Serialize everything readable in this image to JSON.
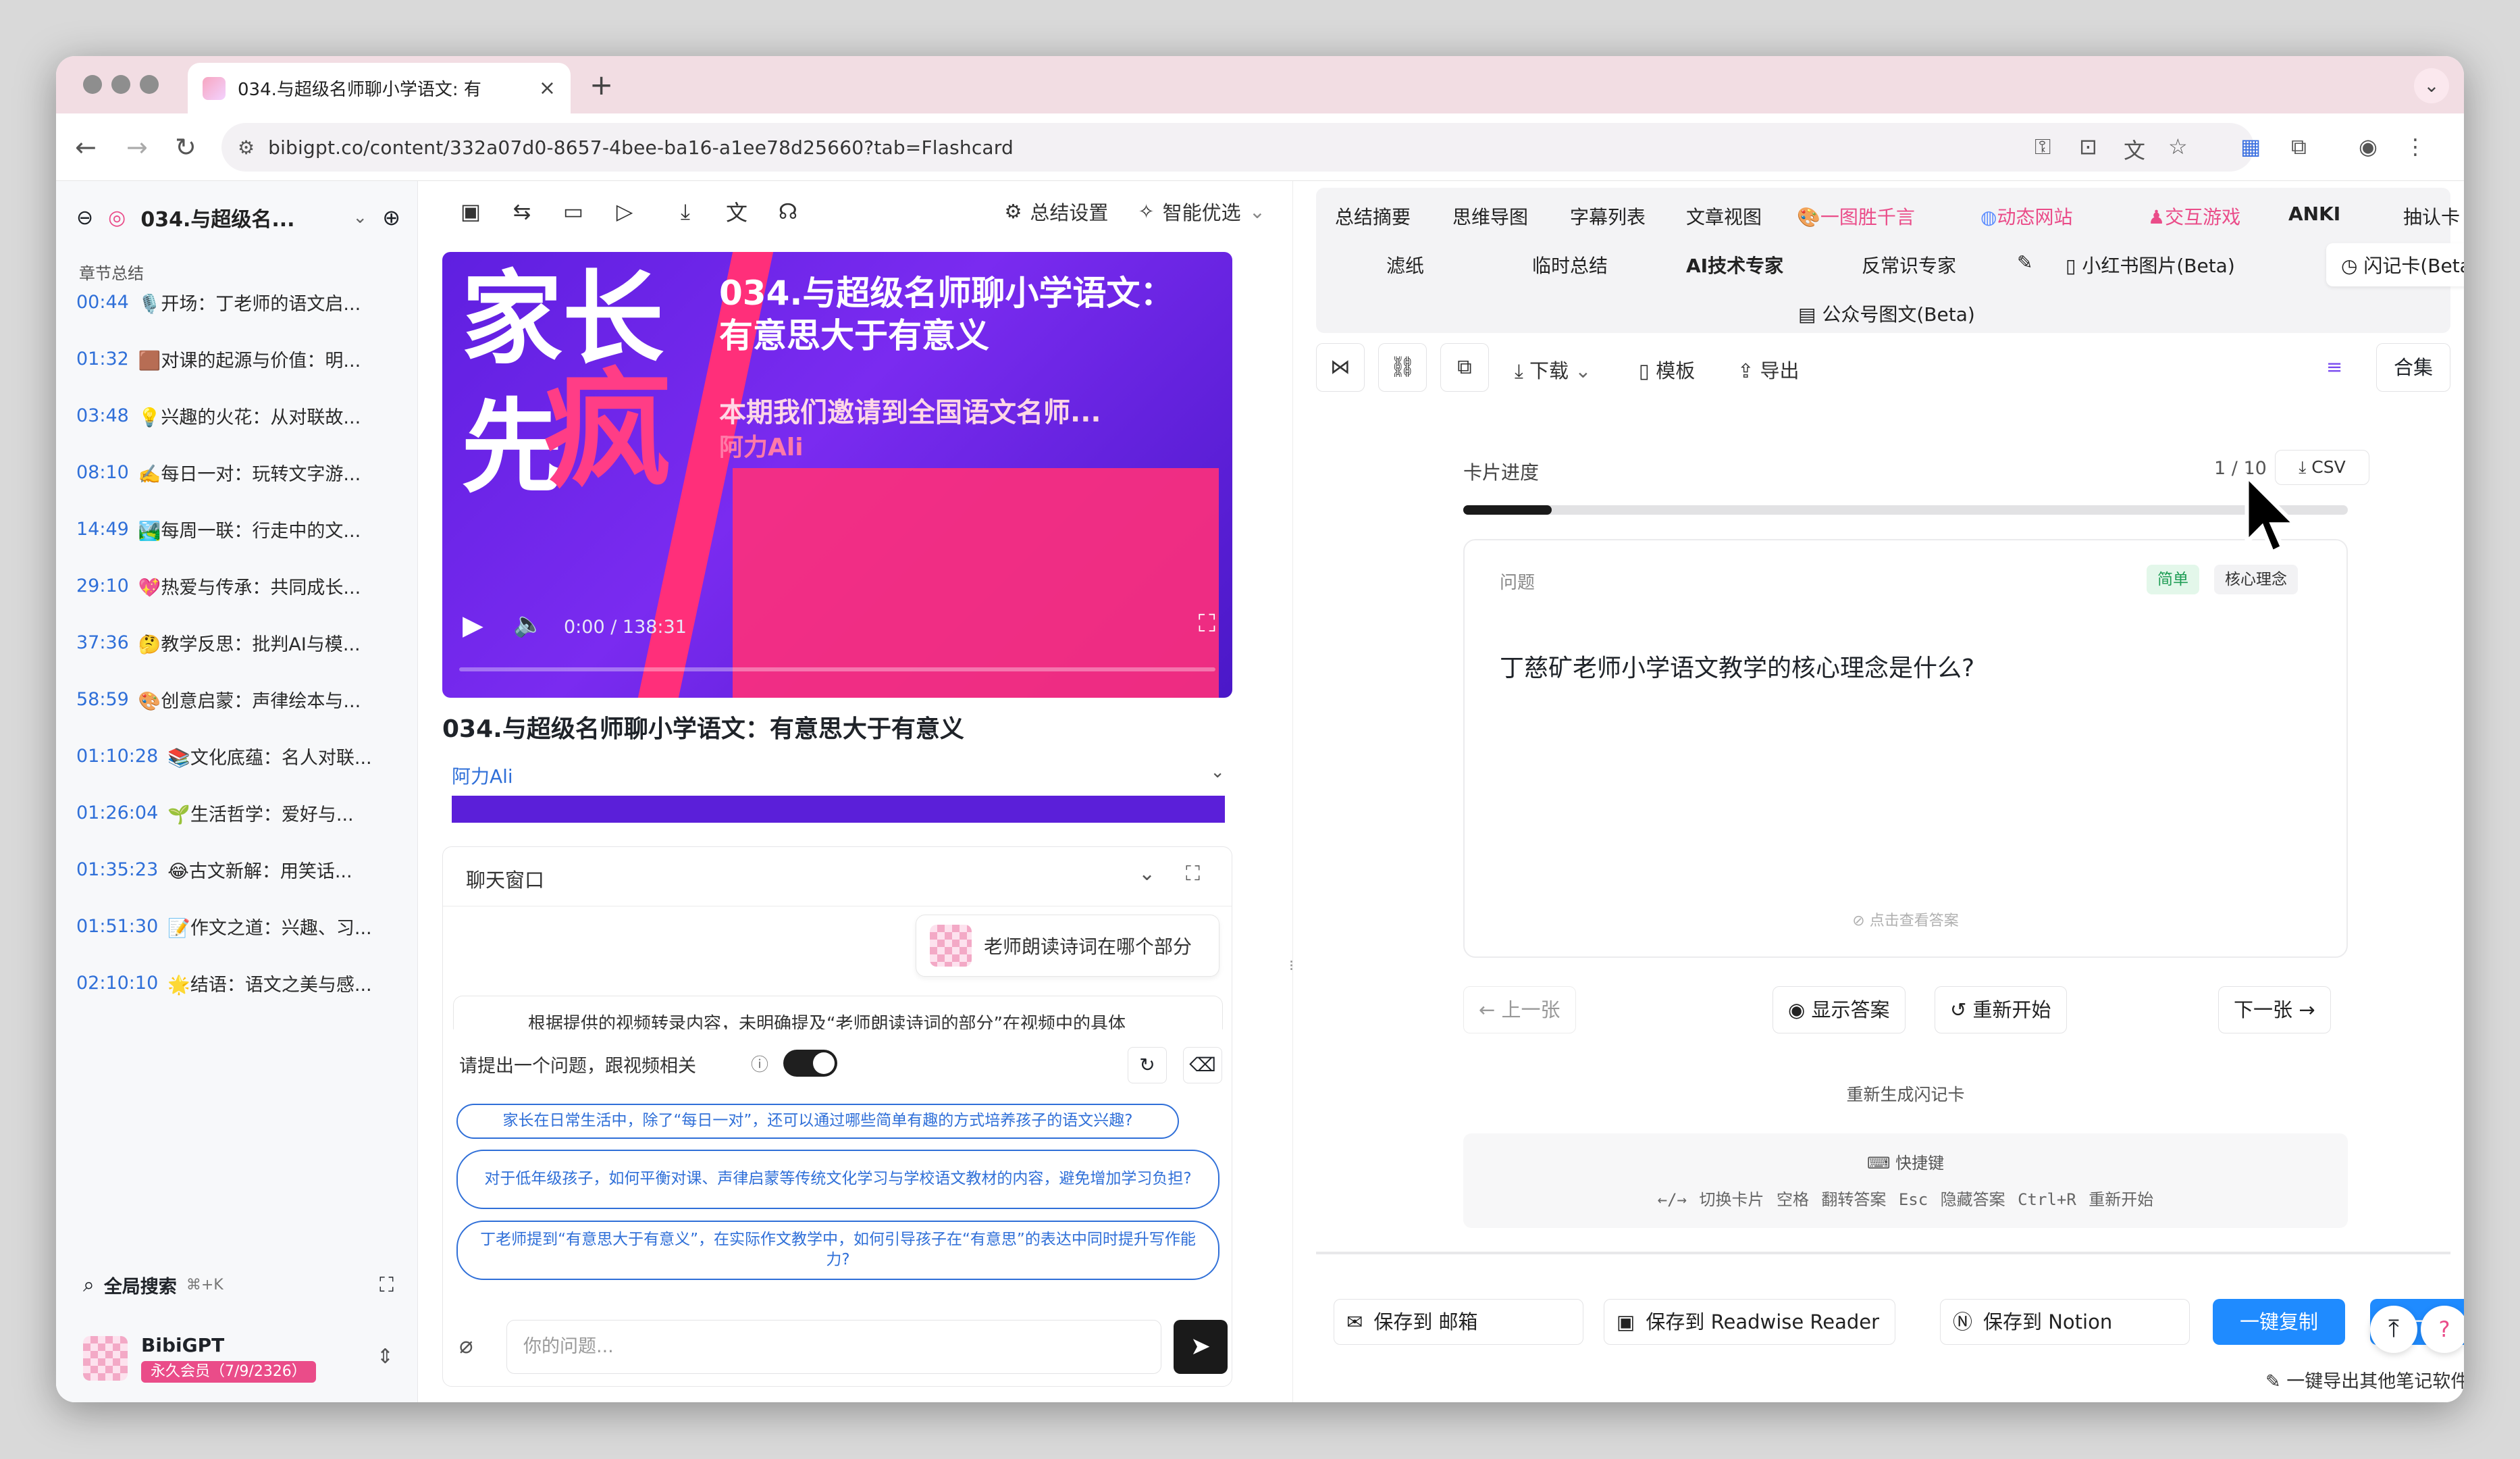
{
  "browser": {
    "tab_title": "034.与超级名师聊小学语文: 有",
    "url": "bibigpt.co/content/332a07d0-8657-4bee-ba16-a1ee78d25660?tab=Flashcard"
  },
  "sidebar": {
    "title": "034.与超级名...",
    "section_label": "章节总结",
    "chapters": [
      {
        "time": "00:44",
        "text": "🎙️开场：丁老师的语文启..."
      },
      {
        "time": "01:32",
        "text": "🟫对课的起源与价值：明..."
      },
      {
        "time": "03:48",
        "text": "💡兴趣的火花：从对联故..."
      },
      {
        "time": "08:10",
        "text": "✍️每日一对：玩转文字游..."
      },
      {
        "time": "14:49",
        "text": "🏞️每周一联：行走中的文..."
      },
      {
        "time": "29:10",
        "text": "💖热爱与传承：共同成长..."
      },
      {
        "time": "37:36",
        "text": "🤔教学反思：批判AI与模..."
      },
      {
        "time": "58:59",
        "text": "🎨创意启蒙：声律绘本与..."
      },
      {
        "time": "01:10:28",
        "text": "📚文化底蕴：名人对联..."
      },
      {
        "time": "01:26:04",
        "text": "🌱生活哲学：爱好与..."
      },
      {
        "time": "01:35:23",
        "text": "😂古文新解：用笑话..."
      },
      {
        "time": "01:51:30",
        "text": "📝作文之道：兴趣、习..."
      },
      {
        "time": "02:10:10",
        "text": "🌟结语：语文之美与感..."
      }
    ],
    "search_label": "全局搜索",
    "search_shortcut": "⌘+K",
    "user_name": "BibiGPT",
    "user_badge": "永久会员（7/9/2326）"
  },
  "middle": {
    "toolbar": {
      "summary_settings": "总结设置",
      "smart_pick": "智能优选"
    },
    "video": {
      "cover_big_1": "家长",
      "cover_big_2": "先",
      "cover_big_3": "疯",
      "cover_title": "034.与超级名师聊小学语文：有意思大于有意义",
      "cover_sub": "本期我们邀请到全国语文名师...",
      "cover_sub2": "阿力Ali",
      "time": "0:00 / 138:31"
    },
    "video_title": "034.与超级名师聊小学语文：有意思大于有意义",
    "author": "阿力Ali",
    "chat": {
      "title": "聊天窗口",
      "user_message": "老师朗读诗词在哪个部分",
      "answer_peek": "根据提供的视频转录内容，未明确提及“老师朗读诗词的部分”在视频中的具体",
      "ask_label": "请提出一个问题，跟视频相关",
      "suggestions": [
        "家长在日常生活中，除了“每日一对”，还可以通过哪些简单有趣的方式培养孩子的语文兴趣?",
        "对于低年级孩子，如何平衡对课、声律启蒙等传统文化学习与学校语文教材的内容，避免增加学习负担?",
        "丁老师提到“有意思大于有意义”，在实际作文教学中，如何引导孩子在“有意思”的表达中同时提升写作能力?"
      ],
      "input_placeholder": "你的问题..."
    }
  },
  "right": {
    "tabs_row1": [
      "总结摘要",
      "思维导图",
      "字幕列表",
      "文章视图",
      "一图胜千言",
      "动态网站",
      "交互游戏",
      "ANKI",
      "抽认卡"
    ],
    "tabs_row2": [
      "滤纸",
      "临时总结",
      "AI技术专家",
      "反常识专家",
      "小红书图片(Beta)",
      "闪记卡(Beta)"
    ],
    "tabs_row3": [
      "公众号图文(Beta)"
    ],
    "toolbar": {
      "download": "下载",
      "template": "模板",
      "export": "导出",
      "collection": "合集"
    },
    "flashcard": {
      "progress_label": "卡片进度",
      "progress_count": "1 / 10",
      "progress_fraction": 0.1,
      "csv": "CSV",
      "card_label": "问题",
      "tag_easy": "简单",
      "tag_concept": "核心理念",
      "question": "丁慈矿老师小学语文教学的核心理念是什么?",
      "hint": "点击查看答案",
      "prev": "上一张",
      "show_answer": "显示答案",
      "restart": "重新开始",
      "next": "下一张",
      "regenerate": "重新生成闪记卡",
      "shortcut_title": "快捷键",
      "shortcut_keys": "←/→ 切换卡片   空格 翻转答案   Esc 隐藏答案   Ctrl+R 重新开始"
    },
    "save": {
      "email": "保存到 邮箱",
      "readwise": "保存到 Readwise Reader",
      "notion": "保存到 Notion",
      "copy": "一键复制",
      "more": "一键",
      "export_all": "一键导出其他笔记软件"
    }
  },
  "colors": {
    "accent_blue": "#2f6fd8",
    "brand_pink": "#ea4c89",
    "button_blue": "#1f8bff"
  }
}
